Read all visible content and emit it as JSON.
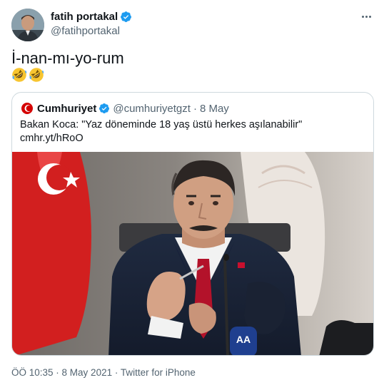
{
  "author": {
    "name": "fatih portakal",
    "handle": "@fatihportakal",
    "verified_icon": "verified-badge",
    "avatar_icon": "avatar-photo"
  },
  "menu": {
    "more_icon": "more-icon"
  },
  "tweet": {
    "text": "İ-nan-mı-yo-rum",
    "emojis": [
      "rolling-on-floor-laughing",
      "rolling-on-floor-laughing"
    ]
  },
  "quote": {
    "name": "Cumhuriyet",
    "handle": "@cumhuriyetgzt",
    "separator": "·",
    "date": "8 May",
    "text_line1": "Bakan Koca: \"Yaz döneminde 18 yaş üstü herkes aşılanabilir\"",
    "text_line2": "cmhr.yt/hRoO",
    "image_icon": "news-photo"
  },
  "meta": {
    "time": "ÖÖ 10:35",
    "separator1": " · ",
    "date": "8 May 2021",
    "separator2": " · ",
    "source": "Twitter for iPhone"
  },
  "colors": {
    "text": "#0f1419",
    "secondary": "#536471",
    "verified": "#1d9bf0",
    "border": "#cfd9de",
    "cumhuriyet_red": "#d40000"
  }
}
